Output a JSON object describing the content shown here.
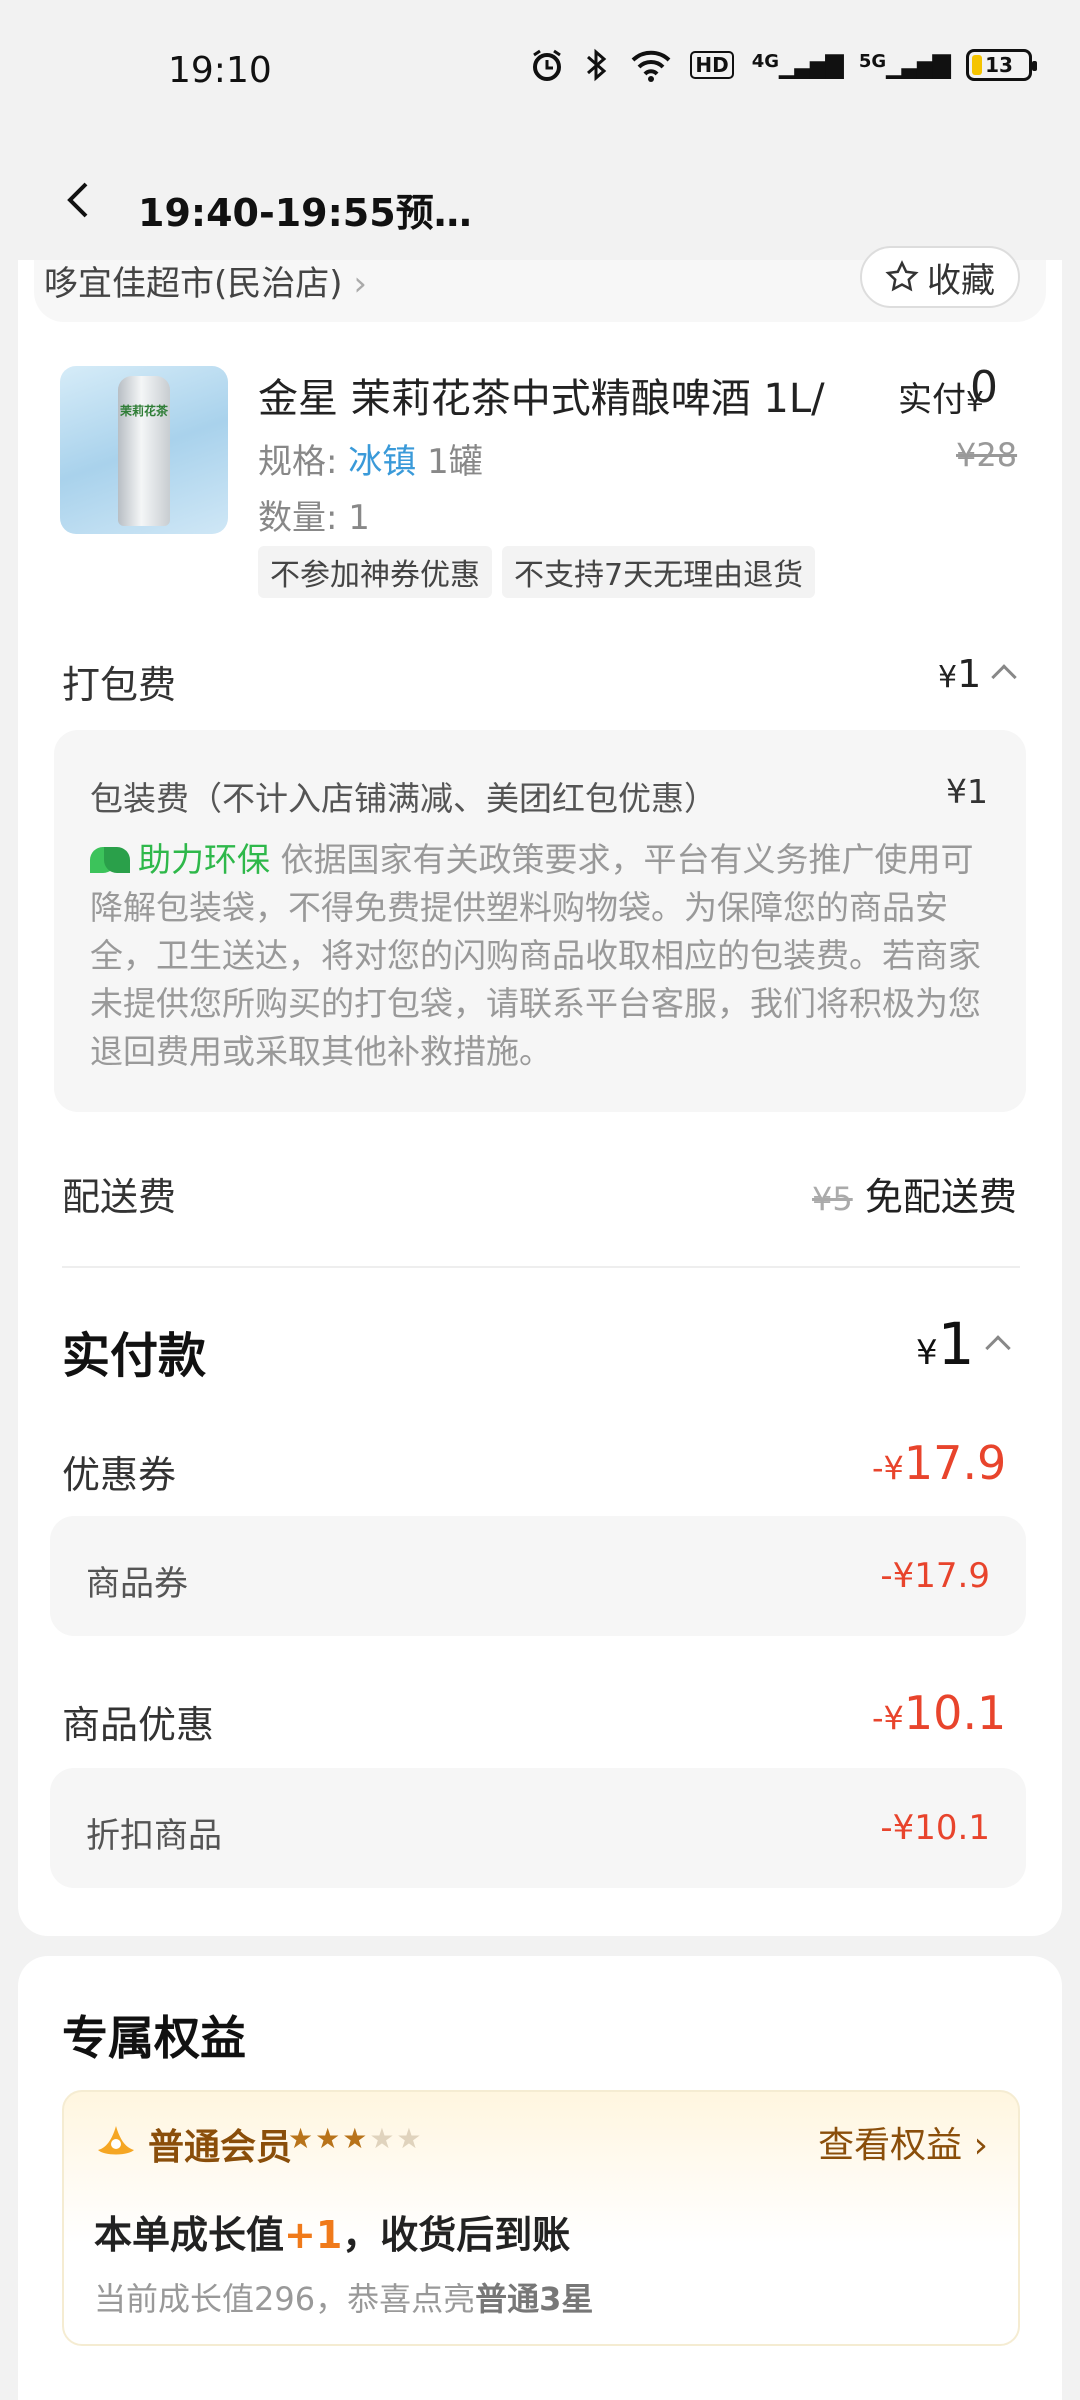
{
  "status_bar": {
    "time": "19:10",
    "battery": "13",
    "net1": "4G",
    "net2": "5G",
    "hd": "HD"
  },
  "nav": {
    "title": "19:40-19:55预…"
  },
  "store": {
    "name": "哆宜佳超市(民治店)",
    "favorite_label": "收藏"
  },
  "product": {
    "title": "金星 茉莉花茶中式精酿啤酒 1L/",
    "can_label": "茉莉花茶",
    "paid_label": "实付",
    "paid_currency": "¥",
    "paid_value": "0",
    "original_price": "¥28",
    "spec_label": "规格: ",
    "spec_value": "冰镇",
    "spec_unit": " 1罐",
    "quantity": "数量: 1",
    "tags": [
      "不参加神券优惠",
      "不支持7天无理由退货"
    ]
  },
  "packing": {
    "label": "打包费",
    "currency": "¥",
    "value": "1",
    "detail_title": "包装费（不计入店铺满减、美团红包优惠）",
    "detail_value": "¥1",
    "eco_label": "助力环保",
    "eco_text": " 依据国家有关政策要求，平台有义务推广使用可降解包装袋，不得免费提供塑料购物袋。为保障您的商品安全，卫生送达，将对您的闪购商品收取相应的包装费。若商家未提供您所购买的打包袋，请联系平台客服，我们将积极为您退回费用或采取其他补救措施。"
  },
  "delivery": {
    "label": "配送费",
    "original": "¥5",
    "value": "免配送费"
  },
  "total": {
    "label": "实付款",
    "currency": "¥",
    "value": "1"
  },
  "coupon": {
    "label": "优惠券",
    "currency": "-¥",
    "value": "17.9",
    "sub_label": "商品券",
    "sub_value": "-¥17.9"
  },
  "discount": {
    "label": "商品优惠",
    "currency": "-¥",
    "value": "10.1",
    "sub_label": "折扣商品",
    "sub_value": "-¥10.1"
  },
  "benefits": {
    "title": "专属权益",
    "level": "普通会员",
    "stars_on": "★★★",
    "stars_off": "★★",
    "view_label": "查看权益",
    "growth_prefix": "本单成长值",
    "growth_plus": "+1",
    "growth_suffix": "，收货后到账",
    "current_prefix": "当前成长值296，恭喜点亮",
    "current_level": "普通3星"
  }
}
